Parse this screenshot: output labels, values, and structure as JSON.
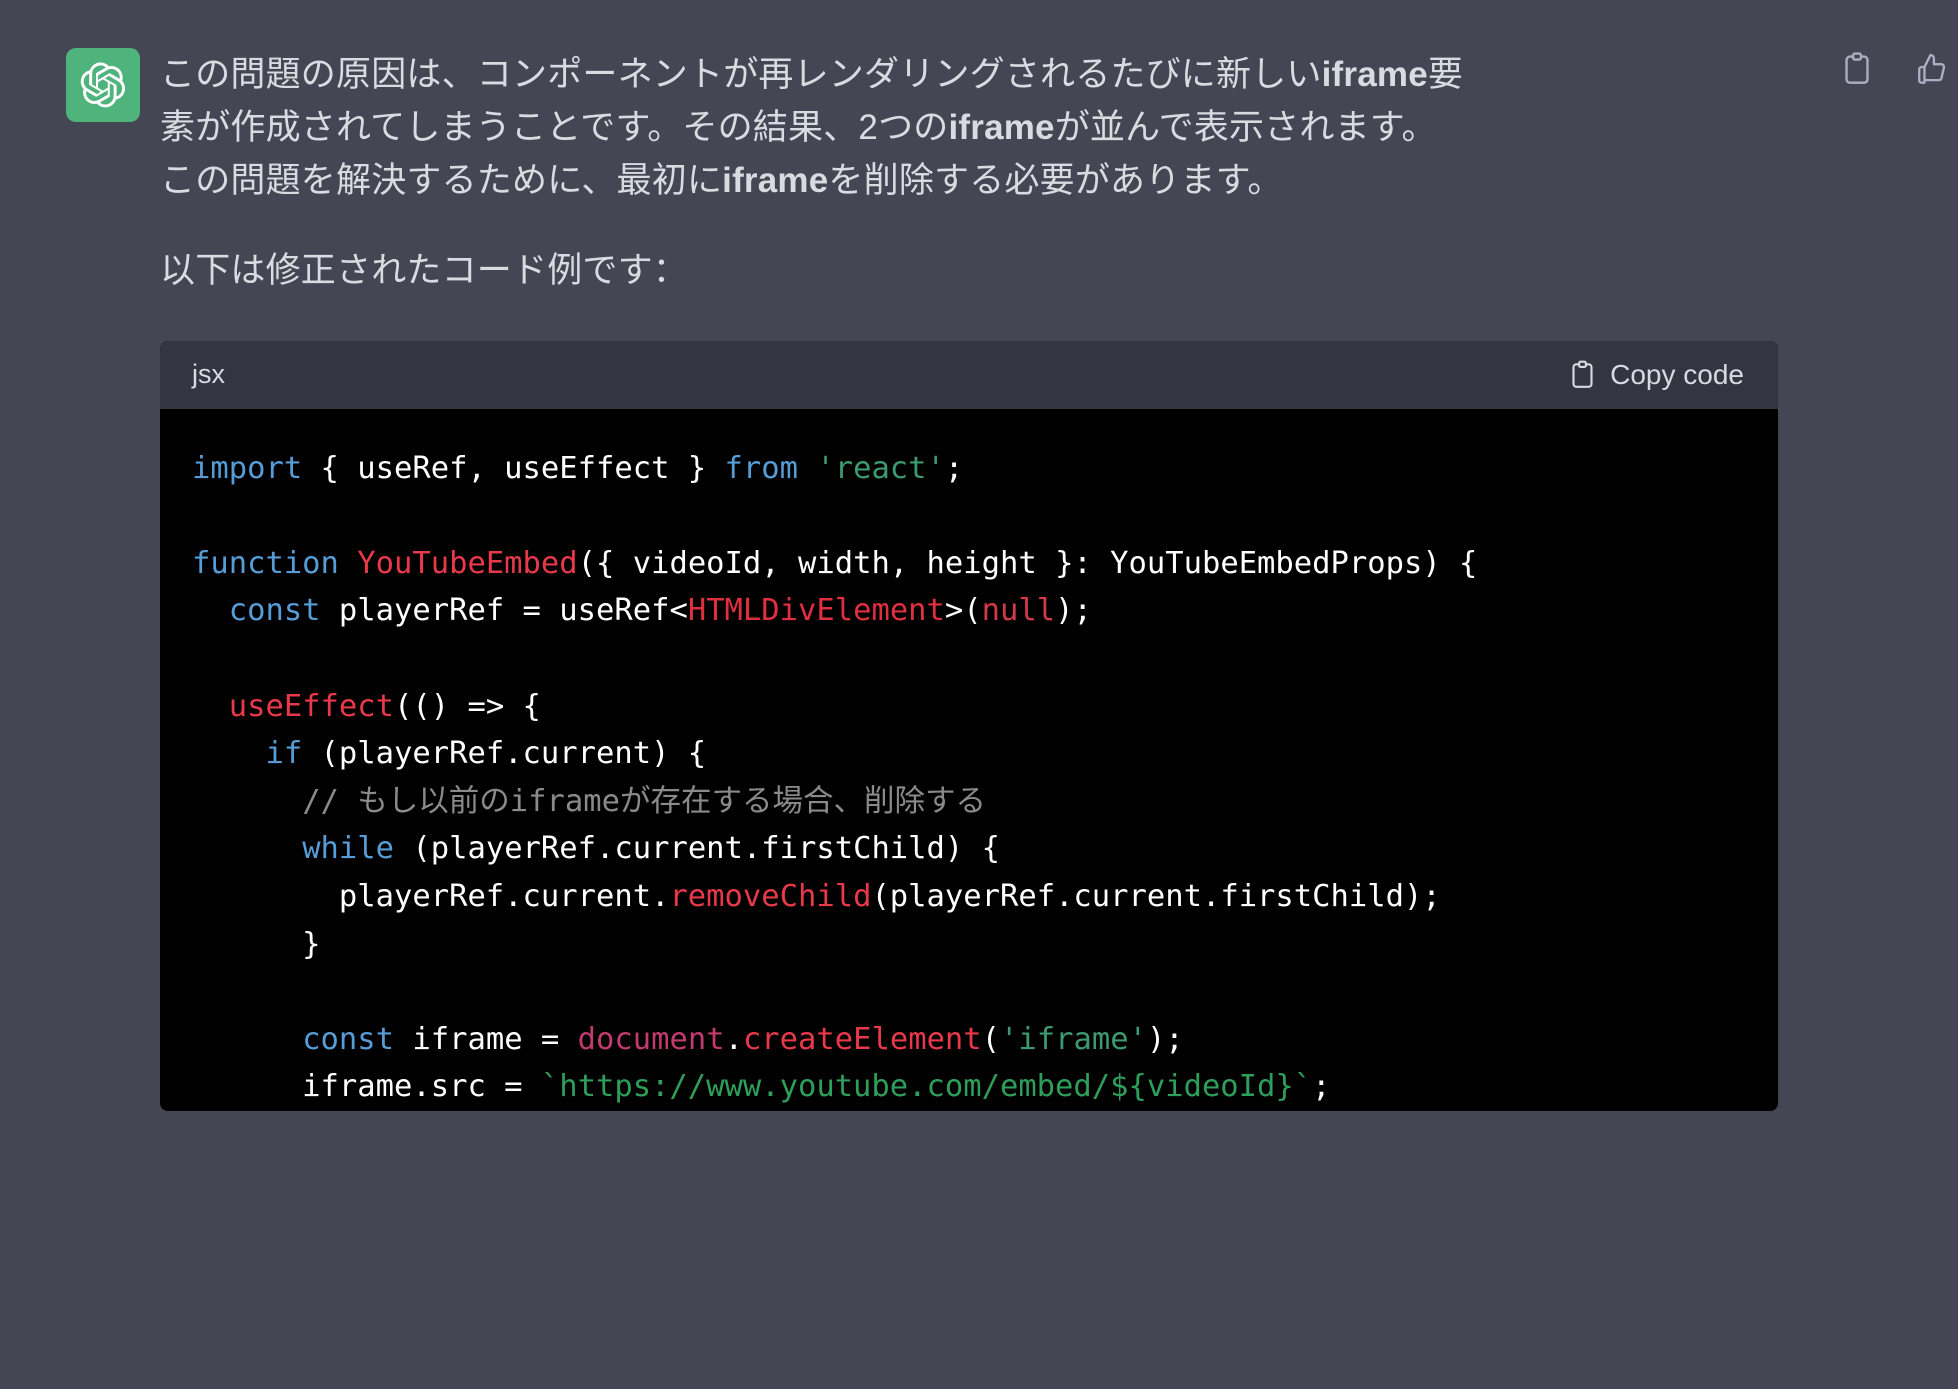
{
  "message": {
    "avatar_icon": "openai-logo-icon",
    "avatar_color": "#4fb37c",
    "paragraphs": [
      "この問題の原因は、コンポーネントが再レンダリングされるたびに新しいiframe要素が作成されてしまうことです。その結果、2つのiframeが並んで表示されます。この問題を解決するために、最初にiframeを削除する必要があります。",
      "以下は修正されたコード例です："
    ]
  },
  "actions": [
    {
      "name": "copy-message-icon",
      "label": "Copy"
    },
    {
      "name": "thumbs-up-icon",
      "label": "Good response"
    }
  ],
  "code_block": {
    "language": "jsx",
    "copy_label": "Copy code",
    "copy_icon": "clipboard-icon",
    "lines": [
      [
        {
          "t": "import",
          "c": "kw"
        },
        {
          "t": " { useRef, useEffect } ",
          "c": "plain"
        },
        {
          "t": "from",
          "c": "kw"
        },
        {
          "t": " ",
          "c": "plain"
        },
        {
          "t": "'react'",
          "c": "str"
        },
        {
          "t": ";",
          "c": "plain"
        }
      ],
      [],
      [
        {
          "t": "function",
          "c": "kw"
        },
        {
          "t": " ",
          "c": "plain"
        },
        {
          "t": "YouTubeEmbed",
          "c": "fn"
        },
        {
          "t": "({ videoId, width, height }: YouTubeEmbedProps) {",
          "c": "plain"
        }
      ],
      [
        {
          "t": "  ",
          "c": "plain"
        },
        {
          "t": "const",
          "c": "kw"
        },
        {
          "t": " playerRef = useRef<",
          "c": "plain"
        },
        {
          "t": "HTMLDivElement",
          "c": "type"
        },
        {
          "t": ">(",
          "c": "plain"
        },
        {
          "t": "null",
          "c": "null"
        },
        {
          "t": ");",
          "c": "plain"
        }
      ],
      [],
      [
        {
          "t": "  ",
          "c": "plain"
        },
        {
          "t": "useEffect",
          "c": "fn"
        },
        {
          "t": "(() => {",
          "c": "plain"
        }
      ],
      [
        {
          "t": "    ",
          "c": "plain"
        },
        {
          "t": "if",
          "c": "kw"
        },
        {
          "t": " (playerRef.current) {",
          "c": "plain"
        }
      ],
      [
        {
          "t": "      ",
          "c": "plain"
        },
        {
          "t": "// もし以前のiframeが存在する場合、削除する",
          "c": "cmt"
        }
      ],
      [
        {
          "t": "      ",
          "c": "plain"
        },
        {
          "t": "while",
          "c": "kw"
        },
        {
          "t": " (playerRef.current.firstChild) {",
          "c": "plain"
        }
      ],
      [
        {
          "t": "        playerRef.current.",
          "c": "plain"
        },
        {
          "t": "removeChild",
          "c": "fn"
        },
        {
          "t": "(playerRef.current.firstChild);",
          "c": "plain"
        }
      ],
      [
        {
          "t": "      }",
          "c": "plain"
        }
      ],
      [],
      [
        {
          "t": "      ",
          "c": "plain"
        },
        {
          "t": "const",
          "c": "kw"
        },
        {
          "t": " iframe = ",
          "c": "plain"
        },
        {
          "t": "document",
          "c": "obj"
        },
        {
          "t": ".",
          "c": "plain"
        },
        {
          "t": "createElement",
          "c": "fn"
        },
        {
          "t": "(",
          "c": "plain"
        },
        {
          "t": "'iframe'",
          "c": "str"
        },
        {
          "t": ");",
          "c": "plain"
        }
      ],
      [
        {
          "t": "      iframe.src = ",
          "c": "plain"
        },
        {
          "t": "`https://www.youtube.com/embed/${videoId}`",
          "c": "str2"
        },
        {
          "t": ";",
          "c": "plain"
        }
      ]
    ]
  },
  "colors": {
    "background": "#444654",
    "code_background": "#000000",
    "code_header_background": "#343541",
    "text": "#d9dbe0",
    "accent_green": "#4fb37c"
  }
}
